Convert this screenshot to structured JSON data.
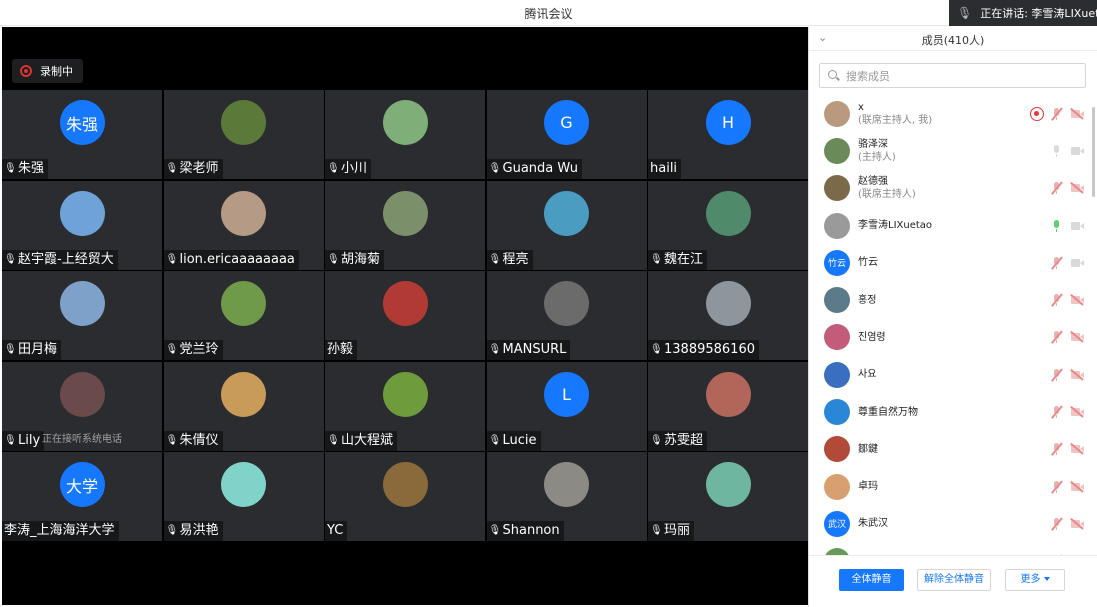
{
  "window": {
    "title": "腾讯会议"
  },
  "speaking": {
    "label": "正在讲话: 李雪涛LIXuetao"
  },
  "recording": {
    "label": "录制中"
  },
  "tiles": [
    {
      "name": "朱强",
      "avatar_text": "朱强",
      "avatar_color": "#1677ff",
      "muted": true
    },
    {
      "name": "梁老师",
      "avatar_text": "",
      "avatar_color": "#5b7a3a",
      "muted": true
    },
    {
      "name": "小川",
      "avatar_text": "",
      "avatar_color": "#7fae78",
      "muted": true
    },
    {
      "name": "Guanda Wu",
      "avatar_text": "G",
      "avatar_color": "#1677ff",
      "muted": true
    },
    {
      "name": "haili",
      "avatar_text": "H",
      "avatar_color": "#1677ff",
      "muted": false
    },
    {
      "name": "赵宇霞-上经贸大",
      "avatar_text": "",
      "avatar_color": "#6fa2d8",
      "muted": true
    },
    {
      "name": "lion.ericaaaaaaaa",
      "avatar_text": "",
      "avatar_color": "#b59a86",
      "muted": true
    },
    {
      "name": "胡海菊",
      "avatar_text": "",
      "avatar_color": "#7a8f6a",
      "muted": true
    },
    {
      "name": "程亮",
      "avatar_text": "",
      "avatar_color": "#4a9cc0",
      "muted": true
    },
    {
      "name": "魏在江",
      "avatar_text": "",
      "avatar_color": "#4f8a6b",
      "muted": true
    },
    {
      "name": "田月梅",
      "avatar_text": "",
      "avatar_color": "#7da1c8",
      "muted": true
    },
    {
      "name": "党兰玲",
      "avatar_text": "",
      "avatar_color": "#6f9a4a",
      "muted": true
    },
    {
      "name": "孙毅",
      "avatar_text": "",
      "avatar_color": "#b23a34",
      "muted": false
    },
    {
      "name": "MANSURL",
      "avatar_text": "",
      "avatar_color": "#6b6b6b",
      "muted": true
    },
    {
      "name": "13889586160",
      "avatar_text": "",
      "avatar_color": "#8e959c",
      "muted": true
    },
    {
      "name": "Lily",
      "avatar_text": "",
      "avatar_color": "#6a4a4a",
      "muted": true,
      "hint": "正在接听系统电话"
    },
    {
      "name": "朱倩仪",
      "avatar_text": "",
      "avatar_color": "#c89b58",
      "muted": true
    },
    {
      "name": "山大程斌",
      "avatar_text": "",
      "avatar_color": "#6e9b3c",
      "muted": true
    },
    {
      "name": "Lucie",
      "avatar_text": "L",
      "avatar_color": "#1677ff",
      "muted": true
    },
    {
      "name": "苏雯超",
      "avatar_text": "",
      "avatar_color": "#b2665a",
      "muted": true
    },
    {
      "name": "李涛_上海海洋大学",
      "avatar_text": "大学",
      "avatar_color": "#1677ff",
      "muted": false
    },
    {
      "name": "易洪艳",
      "avatar_text": "",
      "avatar_color": "#7fd3c8",
      "muted": true
    },
    {
      "name": "YC",
      "avatar_text": "",
      "avatar_color": "#8a6a3a",
      "muted": false
    },
    {
      "name": "Shannon",
      "avatar_text": "",
      "avatar_color": "#8b8a84",
      "muted": true
    },
    {
      "name": "玛丽",
      "avatar_text": "",
      "avatar_color": "#6fb6a0",
      "muted": true
    }
  ],
  "panel": {
    "title": "成员(410人)",
    "search_placeholder": "搜索成员",
    "members": [
      {
        "name": "x",
        "role": "(联席主持人, 我)",
        "avatar_text": "",
        "avatar_color": "#b99a7f",
        "rec": true,
        "mic": "muted",
        "cam": "off"
      },
      {
        "name": "骆泽深",
        "role": "(主持人)",
        "avatar_text": "",
        "avatar_color": "#6b8a5a",
        "rec": false,
        "mic": "idle",
        "cam": "idle"
      },
      {
        "name": "赵德强",
        "role": "(联席主持人)",
        "avatar_text": "",
        "avatar_color": "#7a6a4a",
        "rec": false,
        "mic": "muted",
        "cam": "off"
      },
      {
        "name": "李雪涛LIXuetao",
        "role": "",
        "avatar_text": "",
        "avatar_color": "#9a9a9a",
        "rec": false,
        "mic": "on",
        "cam": "idle"
      },
      {
        "name": "竹云",
        "role": "",
        "avatar_text": "竹云",
        "avatar_color": "#1677ff",
        "rec": false,
        "mic": "muted",
        "cam": "idle"
      },
      {
        "name": "홍정",
        "role": "",
        "avatar_text": "",
        "avatar_color": "#5b7a8a",
        "rec": false,
        "mic": "muted",
        "cam": "off"
      },
      {
        "name": "진염령",
        "role": "",
        "avatar_text": "",
        "avatar_color": "#c25c7a",
        "rec": false,
        "mic": "muted",
        "cam": "off"
      },
      {
        "name": "사요",
        "role": "",
        "avatar_text": "",
        "avatar_color": "#3a6fc0",
        "rec": false,
        "mic": "muted",
        "cam": "off"
      },
      {
        "name": "尊重自然万物",
        "role": "",
        "avatar_text": "",
        "avatar_color": "#2a86d6",
        "rec": false,
        "mic": "muted",
        "cam": "off"
      },
      {
        "name": "鄒鍵",
        "role": "",
        "avatar_text": "",
        "avatar_color": "#b24a3a",
        "rec": false,
        "mic": "muted",
        "cam": "off"
      },
      {
        "name": "卓玛",
        "role": "",
        "avatar_text": "",
        "avatar_color": "#d8a070",
        "rec": false,
        "mic": "muted",
        "cam": "off"
      },
      {
        "name": "朱武汉",
        "role": "",
        "avatar_text": "武汉",
        "avatar_color": "#1677ff",
        "rec": false,
        "mic": "muted",
        "cam": "off"
      },
      {
        "name": "",
        "role": "",
        "avatar_text": "",
        "avatar_color": "#6a9a5a",
        "rec": false,
        "mic": "muted",
        "cam": "off"
      }
    ],
    "buttons": {
      "mute_all": "全体静音",
      "unmute_all": "解除全体静音",
      "more": "更多"
    }
  }
}
